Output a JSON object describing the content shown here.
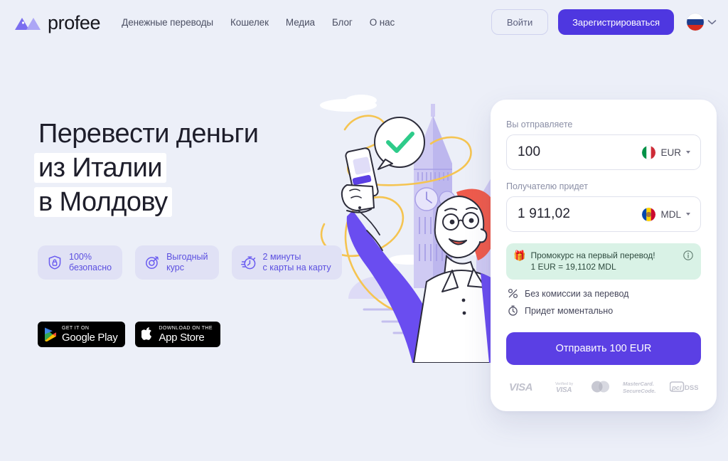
{
  "brand": {
    "name": "profee",
    "logo_icon": "mountain-logo-icon",
    "primary": "#4e37e0",
    "accent": "#5b3fe4",
    "background": "#eceff8"
  },
  "header": {
    "nav": [
      {
        "label": "Денежные переводы"
      },
      {
        "label": "Кошелек"
      },
      {
        "label": "Медиа"
      },
      {
        "label": "Блог"
      },
      {
        "label": "О нас"
      }
    ],
    "login_label": "Войти",
    "register_label": "Зарегистрироваться",
    "language": {
      "flag_icon": "flag-ru-icon",
      "chevron_icon": "chevron-down-icon"
    }
  },
  "hero": {
    "headline_line1": "Перевести деньги",
    "headline_line2": "из Италии",
    "headline_line3": "в Молдову",
    "features": [
      {
        "icon": "shield-lock-icon",
        "text": "100%\nбезопасно"
      },
      {
        "icon": "target-rate-icon",
        "text": "Выгодный\nкурс"
      },
      {
        "icon": "stopwatch-icon",
        "text": "2 минуты\nс карты на карту"
      }
    ],
    "stores": [
      {
        "icon": "google-play-icon",
        "small": "GET IT ON",
        "big": "Google Play"
      },
      {
        "icon": "apple-icon",
        "small": "Download on the",
        "big": "App Store"
      }
    ]
  },
  "illustration": {
    "name": "person-with-phone-big-ben-illustration"
  },
  "calculator": {
    "send_label": "Вы отправляете",
    "send_value": "100",
    "send_currency": "EUR",
    "send_flag_icon": "flag-it-icon",
    "receive_label": "Получателю придет",
    "receive_value": "1 911,02",
    "receive_currency": "MDL",
    "receive_flag_icon": "flag-md-icon",
    "promo": {
      "emoji": "🎁",
      "line1": "Промокурс на первый перевод!",
      "line2": "1 EUR = 19,1102 MDL",
      "info_icon": "info-circle-icon",
      "background": "#d9f2e6"
    },
    "info_rows": [
      {
        "icon": "percent-icon",
        "text": "Без комиссии за перевод"
      },
      {
        "icon": "clock-icon",
        "text": "Придет моментально"
      }
    ],
    "send_button_label": "Отправить 100 EUR",
    "payment_logos": [
      {
        "name": "visa-logo",
        "text": "VISA"
      },
      {
        "name": "verified-by-visa-logo",
        "text_top": "Verified by",
        "text_bottom": "VISA"
      },
      {
        "name": "mastercard-logo",
        "text": ""
      },
      {
        "name": "mastercard-securecode-logo",
        "text_top": "MasterCard.",
        "text_bottom": "SecureCode."
      },
      {
        "name": "pci-dss-logo",
        "text": "pci dss"
      }
    ]
  }
}
